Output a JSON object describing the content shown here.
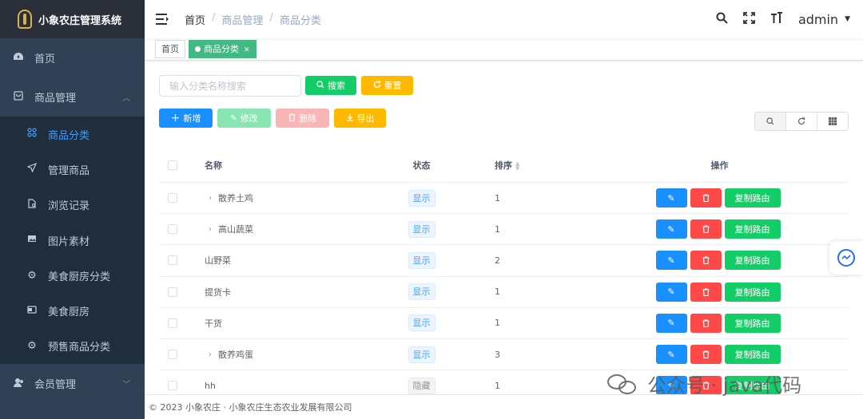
{
  "app": {
    "title": "小象农庄管理系统"
  },
  "sidebar": {
    "items": [
      {
        "label": "首页",
        "icon": "dashboard-icon"
      },
      {
        "label": "商品管理",
        "icon": "shopping-icon",
        "expanded": true,
        "children": [
          {
            "label": "商品分类",
            "icon": "category-icon",
            "active": true
          },
          {
            "label": "管理商品",
            "icon": "send-icon"
          },
          {
            "label": "浏览记录",
            "icon": "document-icon"
          },
          {
            "label": "图片素材",
            "icon": "image-icon"
          },
          {
            "label": "美食厨房分类",
            "icon": "gear-icon"
          },
          {
            "label": "美食厨房",
            "icon": "card-icon"
          },
          {
            "label": "预售商品分类",
            "icon": "gear-icon"
          }
        ]
      },
      {
        "label": "会员管理",
        "icon": "user-icon"
      }
    ]
  },
  "navbar": {
    "breadcrumb": [
      "首页",
      "商品管理",
      "商品分类"
    ],
    "user": "admin"
  },
  "tags": [
    {
      "label": "首页",
      "active": false
    },
    {
      "label": "商品分类",
      "active": true
    }
  ],
  "search": {
    "placeholder": "输入分类名称搜索",
    "search_label": "搜索",
    "reset_label": "重置"
  },
  "actions": {
    "add_label": "新增",
    "edit_label": "修改",
    "delete_label": "删除",
    "export_label": "导出"
  },
  "table": {
    "headers": {
      "name": "名称",
      "status": "状态",
      "sort": "排序",
      "ops": "操作"
    },
    "copy_label": "复制路由",
    "rows": [
      {
        "name": "散养土鸡",
        "expandable": true,
        "status": "显示",
        "sort": "1"
      },
      {
        "name": "高山蔬菜",
        "expandable": true,
        "status": "显示",
        "sort": "1"
      },
      {
        "name": "山野菜",
        "expandable": false,
        "status": "显示",
        "sort": "2"
      },
      {
        "name": "提货卡",
        "expandable": false,
        "status": "显示",
        "sort": "1"
      },
      {
        "name": "干货",
        "expandable": false,
        "status": "显示",
        "sort": "1"
      },
      {
        "name": "散养鸡蛋",
        "expandable": true,
        "status": "显示",
        "sort": "3"
      },
      {
        "name": "hh",
        "expandable": false,
        "status": "隐藏",
        "sort": "1"
      }
    ]
  },
  "footer": {
    "text": "© 2023 小象农庄 · 小象农庄生态农业发展有限公司"
  },
  "watermark": {
    "text": "公众号 · java代码"
  },
  "colors": {
    "sidebar_bg": "#304156",
    "accent": "#409eff",
    "success": "#13ce66",
    "danger": "#ff4949",
    "warning": "#ffba00",
    "primary": "#1890ff"
  }
}
